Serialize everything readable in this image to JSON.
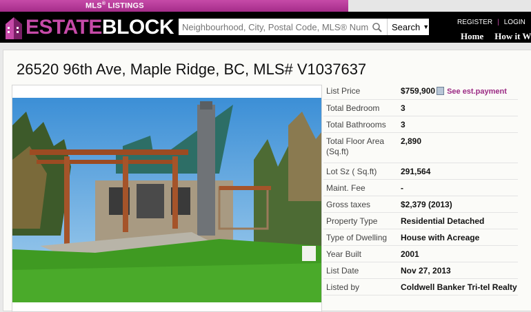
{
  "topbar": {
    "mls_label": "MLS",
    "mls_sup": "®",
    "listings_label": " LISTINGS"
  },
  "header": {
    "logo_estate": "ESTATE",
    "logo_block": "BLOCK",
    "search_placeholder": "Neighbourhood, City, Postal Code, MLS® Number",
    "search_button": "Search",
    "register": "REGISTER",
    "separator": "|",
    "login": "LOGIN",
    "nav": [
      "Home",
      "How it Works"
    ]
  },
  "listing": {
    "title": "26520 96th Ave, Maple Ridge, BC, MLS# V1037637",
    "see_payment": "See est.payment",
    "details": [
      {
        "label": "List Price",
        "value": "$759,900"
      },
      {
        "label": "Total Bedroom",
        "value": "3"
      },
      {
        "label": "Total Bathrooms",
        "value": "3"
      },
      {
        "label": "Total Floor Area (Sq.ft)",
        "value": "2,890"
      },
      {
        "label": "Lot Sz ( Sq.ft)",
        "value": "291,564"
      },
      {
        "label": "Maint. Fee",
        "value": "-"
      },
      {
        "label": "Gross taxes",
        "value": "$2,379 (2013)"
      },
      {
        "label": "Property Type",
        "value": "Residential Detached"
      },
      {
        "label": "Type of Dwelling",
        "value": "House with Acreage"
      },
      {
        "label": "Year Built",
        "value": "2001"
      },
      {
        "label": "List Date",
        "value": "Nov 27, 2013"
      },
      {
        "label": "Listed by",
        "value": "Coldwell Banker Tri-tel Realty"
      }
    ]
  },
  "colors": {
    "brand": "#c64aa8",
    "header_bg": "#000000",
    "link": "#9b2a84"
  }
}
